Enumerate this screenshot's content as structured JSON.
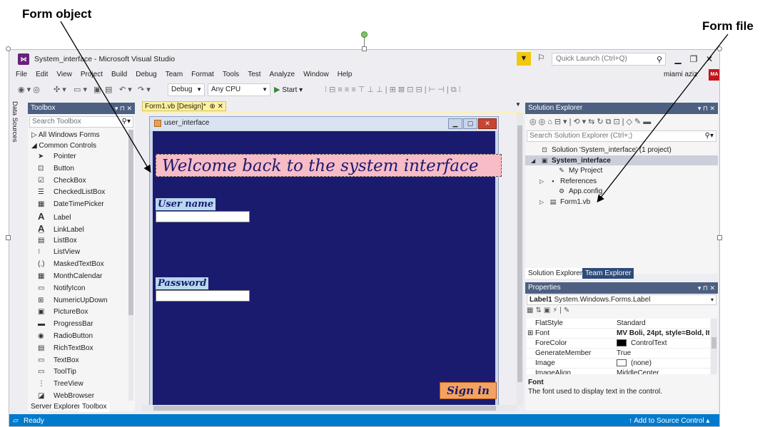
{
  "annotations": {
    "form_object": "Form object",
    "form_file": "Form file"
  },
  "window": {
    "title": "System_interface - Microsoft Visual Studio",
    "quick_launch_placeholder": "Quick Launch (Ctrl+Q)",
    "user": "miami aziz",
    "avatar_initials": "MA"
  },
  "menu": [
    "File",
    "Edit",
    "View",
    "Project",
    "Build",
    "Debug",
    "Team",
    "Format",
    "Tools",
    "Test",
    "Analyze",
    "Window",
    "Help"
  ],
  "toolbar": {
    "config": "Debug",
    "platform": "Any CPU",
    "start": "Start"
  },
  "data_sources_tab": "Data Sources",
  "toolbox": {
    "title": "Toolbox",
    "search_placeholder": "Search Toolbox",
    "group_all": "All Windows Forms",
    "group_common": "Common Controls",
    "items": [
      {
        "label": "Pointer",
        "icon": "pointer-icon"
      },
      {
        "label": "Button",
        "icon": "button-icon"
      },
      {
        "label": "CheckBox",
        "icon": "checkbox-icon"
      },
      {
        "label": "CheckedListBox",
        "icon": "checkedlistbox-icon"
      },
      {
        "label": "DateTimePicker",
        "icon": "datetimepicker-icon"
      },
      {
        "label": "Label",
        "icon": "label-icon"
      },
      {
        "label": "LinkLabel",
        "icon": "linklabel-icon"
      },
      {
        "label": "ListBox",
        "icon": "listbox-icon"
      },
      {
        "label": "ListView",
        "icon": "listview-icon"
      },
      {
        "label": "MaskedTextBox",
        "icon": "maskedtextbox-icon"
      },
      {
        "label": "MonthCalendar",
        "icon": "monthcalendar-icon"
      },
      {
        "label": "NotifyIcon",
        "icon": "notifyicon-icon"
      },
      {
        "label": "NumericUpDown",
        "icon": "numericupdown-icon"
      },
      {
        "label": "PictureBox",
        "icon": "picturebox-icon"
      },
      {
        "label": "ProgressBar",
        "icon": "progressbar-icon"
      },
      {
        "label": "RadioButton",
        "icon": "radiobutton-icon"
      },
      {
        "label": "RichTextBox",
        "icon": "richtextbox-icon"
      },
      {
        "label": "TextBox",
        "icon": "textbox-icon"
      },
      {
        "label": "ToolTip",
        "icon": "tooltip-icon"
      },
      {
        "label": "TreeView",
        "icon": "treeview-icon"
      },
      {
        "label": "WebBrowser",
        "icon": "webbrowser-icon"
      }
    ],
    "tabs": [
      "Server Explorer",
      "Toolbox"
    ]
  },
  "designer": {
    "tab_label": "Form1.vb [Design]*",
    "form_title": "user_interface",
    "welcome_text": "Welcome back to the system interface",
    "username_label": "User name",
    "password_label": "Password",
    "signin_label": "Sign in",
    "colors": {
      "form_background": "#1a1b6e",
      "welcome_background": "#f8bcc7",
      "signin_background": "#f4a261"
    }
  },
  "solution_explorer": {
    "title": "Solution Explorer",
    "search_placeholder": "Search Solution Explorer (Ctrl+;)",
    "tree": [
      {
        "label": "Solution 'System_interface' (1 project)",
        "indent": 0,
        "expander": "",
        "icon": "solution-icon"
      },
      {
        "label": "System_interface",
        "indent": 0,
        "expander": "◢",
        "icon": "vb-project-icon",
        "bold": true
      },
      {
        "label": "My Project",
        "indent": 2,
        "expander": "",
        "icon": "wrench-icon"
      },
      {
        "label": "References",
        "indent": 1,
        "expander": "▷",
        "icon": "references-icon"
      },
      {
        "label": "App.config",
        "indent": 2,
        "expander": "",
        "icon": "config-icon"
      },
      {
        "label": "Form1.vb",
        "indent": 1,
        "expander": "▷",
        "icon": "form-file-icon"
      }
    ],
    "tabs": [
      "Solution Explorer",
      "Team Explorer"
    ]
  },
  "properties": {
    "title": "Properties",
    "object_name": "Label1",
    "object_type": "System.Windows.Forms.Label",
    "rows": [
      {
        "name": "FlatStyle",
        "value": "Standard",
        "bold": false,
        "expander": ""
      },
      {
        "name": "Font",
        "value": "MV Boli, 24pt, style=Bold, It",
        "bold": true,
        "expander": "⊞"
      },
      {
        "name": "ForeColor",
        "value": "ControlText",
        "bold": false,
        "expander": "",
        "swatch": "#000000"
      },
      {
        "name": "GenerateMember",
        "value": "True",
        "bold": false,
        "expander": ""
      },
      {
        "name": "Image",
        "value": "(none)",
        "bold": false,
        "expander": "",
        "swatch": "#ffffff"
      },
      {
        "name": "ImageAlign",
        "value": "MiddleCenter",
        "bold": false,
        "expander": ""
      }
    ],
    "desc_title": "Font",
    "desc_text": "The font used to display text in the control."
  },
  "status": {
    "ready": "Ready",
    "source_control": "↑ Add to Source Control ▴"
  }
}
